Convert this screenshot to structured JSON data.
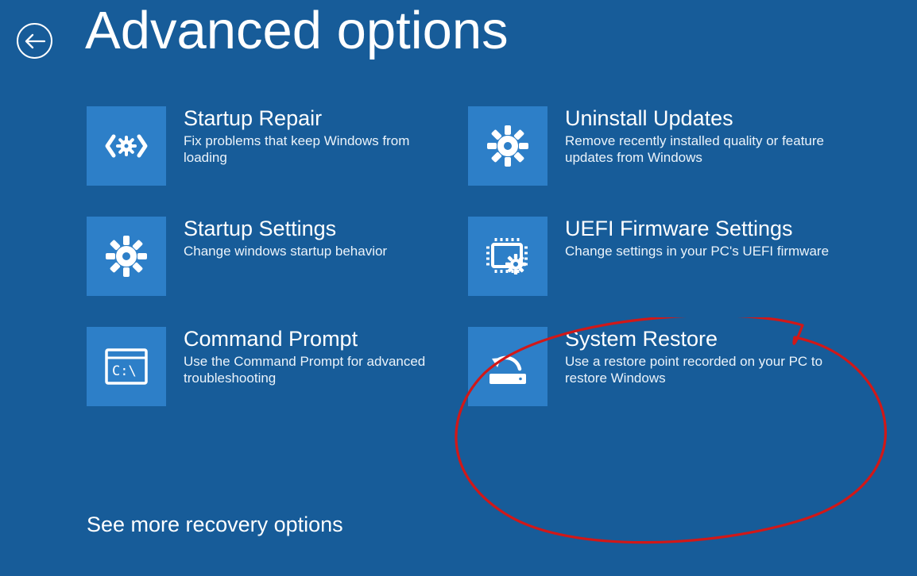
{
  "header": {
    "title": "Advanced options"
  },
  "tiles": {
    "startup_repair": {
      "title": "Startup Repair",
      "desc": "Fix problems that keep Windows from loading"
    },
    "uninstall_updates": {
      "title": "Uninstall Updates",
      "desc": "Remove recently installed quality or feature updates from Windows"
    },
    "startup_settings": {
      "title": "Startup Settings",
      "desc": "Change windows startup behavior"
    },
    "uefi": {
      "title": "UEFI Firmware Settings",
      "desc": "Change settings in your PC's UEFI firmware"
    },
    "command_prompt": {
      "title": "Command Prompt",
      "desc": "Use the Command Prompt for advanced troubleshooting"
    },
    "system_restore": {
      "title": "System Restore",
      "desc": "Use a restore point recorded on your PC to restore Windows"
    }
  },
  "footer": {
    "more": "See more recovery options"
  },
  "annotation": {
    "color": "#d11818",
    "target": "system_restore"
  }
}
